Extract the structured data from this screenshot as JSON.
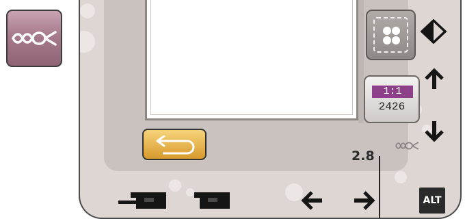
{
  "stitch_button": {
    "icon": "stitch-pattern-icon"
  },
  "preview": {
    "hoop_icon": "embroidery-hoop-icon"
  },
  "scale": {
    "ratio": "1:1",
    "value": "2426"
  },
  "back_button": {
    "icon": "return-arrow-icon"
  },
  "status": {
    "stitch_length": "2.8",
    "stitch_icon": "stitch-pattern-icon"
  },
  "side_controls": [
    "diamond-rotate-icon",
    "arrow-up-icon",
    "arrow-down-icon"
  ],
  "bottom_controls": [
    "presser-foot-icon",
    "presser-foot-icon",
    "arrow-left-icon",
    "arrow-right-icon"
  ],
  "alt_button": {
    "label": "ALT"
  },
  "colors": {
    "accent_purple": "#8e3f8a",
    "back_button_orange": "#e4b04b",
    "panel": "#ddd6d3"
  }
}
